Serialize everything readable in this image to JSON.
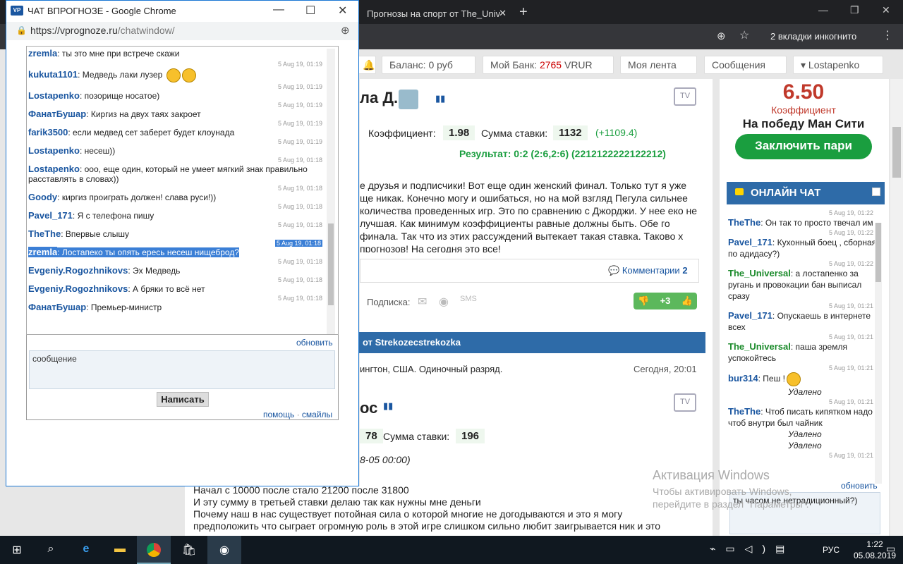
{
  "bg_browser": {
    "tab_title": "Прогнозы на спорт от The_Univ",
    "incognito": "2 вкладки инкогнито",
    "nav": {
      "balance": "Баланс: 0 руб",
      "bank_prefix": "Мой Банк:",
      "bank_value": "2765",
      "bank_suffix": "VRUR",
      "feed": "Моя лента",
      "messages": "Сообщения",
      "user": "Lostapenko"
    }
  },
  "main": {
    "author_partial": "ла Д.",
    "coef_label": "Коэффициент:",
    "coef_value": "1.98",
    "stake_label": "Сумма ставки:",
    "stake_value": "1132",
    "profit": "(+1109.4)",
    "result": "Результат: 0:2 (2:6,2:6) (2212122222122212)",
    "body": "е друзья и подписчики! Вот еще один женский финал. Только тут я уже ще никак. Конечно могу и ошибаться, но на мой взгляд Пегула сильнее количества проведенных игр. Это по сравнению с Джорджи. У нее еко не лучшая. Как минимум коэффициенты равные должны быть. Обе го финала. Так что из этих рассуждений вытекает такая ставка. Таково х прогнозов! На сегодня это все!",
    "comments": "Комментарии",
    "comments_count": "2",
    "subscribe": "Подписка:",
    "rating": "+3",
    "post2_header": "от Strekozecstrekozka",
    "post2_event": "ингтон, США. Одиночный разряд.",
    "post2_date": "Сегодня, 20:01",
    "post2_author": "ос",
    "post2_coef": "78",
    "post2_stake_label": "Сумма ставки:",
    "post2_stake": "196",
    "post2_time": "8-05 00:00)",
    "post2_lines": [
      "Начал с 10000 после стало 21200 после 31800",
      "И эту сумму в третьей ставки делаю так как нужны мне деньги",
      "Почему наш в нас существует потойная сила о которой многие не догодываются и это я могу",
      "предположить что сыграет огромную роль в этой игре слишком сильно любит заигрывается ник и это"
    ]
  },
  "promo": {
    "odds": "6.50",
    "label": "Коэффициент",
    "title": "На победу Ман Сити",
    "button": "Заключить пари"
  },
  "online_chat": {
    "title": "ОНЛАЙН ЧАТ",
    "messages": [
      {
        "ts": "5 Aug 19, 01:22",
        "user": "TheThe",
        "text": ": Он так то просто твечал им",
        "green": false
      },
      {
        "ts": "5 Aug 19, 01:22",
        "user": "Pavel_171",
        "text": ": Кухонный боец , сборная по адидасу?)",
        "green": false
      },
      {
        "ts": "5 Aug 19, 01:22",
        "user": "The_Universal",
        "text": ": а лостапенко за ругань и провокации бан выписал сразу",
        "green": true
      },
      {
        "ts": "5 Aug 19, 01:21",
        "user": "Pavel_171",
        "text": ": Опускаешь в интернете всех",
        "green": false
      },
      {
        "ts": "5 Aug 19, 01:21",
        "user": "The_Universal",
        "text": ": паша зремля успокойтесь",
        "green": true
      },
      {
        "ts": "5 Aug 19, 01:21",
        "user": "bur314",
        "text": ": Пеш  !",
        "green": false,
        "deleted": "Удалено"
      },
      {
        "ts": "5 Aug 19, 01:21",
        "user": "TheThe",
        "text": ": Чтоб писать кипятком надо чтоб внутри был чайник",
        "green": false,
        "deleted": "Удалено"
      },
      {
        "ts": "",
        "user": "",
        "text": "",
        "green": false,
        "deleted": "Удалено"
      },
      {
        "ts": "5 Aug 19, 01:21",
        "user": "",
        "text": "",
        "green": false
      }
    ],
    "refresh": "обновить",
    "input_partial": "ты часом не нетрадиционный?)"
  },
  "watermark": {
    "title": "Активация Windows",
    "text": "Чтобы активировать Windows, перейдите в раздел \"Параметры\"."
  },
  "popup": {
    "window_title": "ЧАТ ВПРОГНОЗЕ - Google Chrome",
    "logo": "VP",
    "url_host": "https://vprognoze.ru",
    "url_path": "/chatwindow/",
    "messages": [
      {
        "user": "zremla",
        "text": ": ты это мне при встрече скажи",
        "ts": ""
      },
      {
        "ts": "5 Aug 19, 01:19",
        "user": "kukuta1101",
        "text": ": Медведь лаки лузер",
        "emoji": true
      },
      {
        "ts": "5 Aug 19, 01:19",
        "user": "Lostapenko",
        "text": ": позорище носатое)"
      },
      {
        "ts": "5 Aug 19, 01:19",
        "user": "ФанатБушар",
        "text": ": Киргиз на двух таях закроет"
      },
      {
        "ts": "5 Aug 19, 01:19",
        "user": "farik3500",
        "text": ": если медвед сет заберет будет клоунада"
      },
      {
        "ts": "5 Aug 19, 01:19",
        "user": "Lostapenko",
        "text": ": несеш))"
      },
      {
        "ts": "5 Aug 19, 01:18",
        "user": "Lostapenko",
        "text": ": ооо, еще один, который не умеет мягкий знак правильно расставлять в словах))"
      },
      {
        "ts": "5 Aug 19, 01:18",
        "user": "Goody",
        "text": ": киргиз проиграть должен! слава руси!))"
      },
      {
        "ts": "5 Aug 19, 01:18",
        "user": "Pavel_171",
        "text": ": Я с телефона пишу"
      },
      {
        "ts": "5 Aug 19, 01:18",
        "user": "TheThe",
        "text": ": Впервые слышу"
      },
      {
        "ts": "5 Aug 19, 01:18",
        "user": "zremla",
        "text": ": Лостапеко ты опять ересь несеш нищеброд?",
        "selected": true
      },
      {
        "ts": "5 Aug 19, 01:18",
        "user": "Evgeniy.Rogozhnikovs",
        "text": ": Эх Медведь"
      },
      {
        "ts": "5 Aug 19, 01:18",
        "user": "Evgeniy.Rogozhnikovs",
        "text": ": А бряки то всё нет"
      },
      {
        "ts": "5 Aug 19, 01:18",
        "user": "ФанатБушар",
        "text": ": Премьер-министр"
      }
    ],
    "refresh": "обновить",
    "input_placeholder": "сообщение",
    "send": "Написать",
    "help": "помощь",
    "sep": "·",
    "smileys": "смайлы"
  },
  "taskbar": {
    "lang": "РУС",
    "time": "1:22",
    "date": "05.08.2019"
  }
}
